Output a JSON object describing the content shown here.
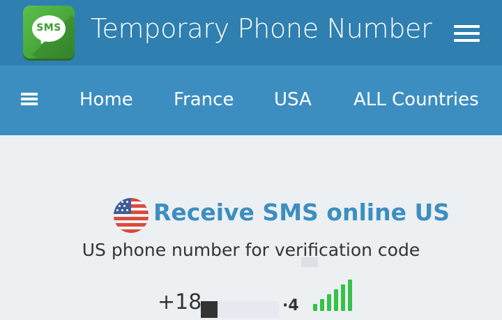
{
  "header": {
    "logo_text": "SMS",
    "title": "Temporary Phone Number",
    "menu_icon": "hamburger-menu-icon"
  },
  "nav": {
    "toggle_icon": "hamburger-icon",
    "links": [
      "Home",
      "France",
      "USA",
      "ALL Countries"
    ]
  },
  "main": {
    "flag_icon": "us-flag-icon",
    "heading": "Receive SMS online US",
    "subheading": "US phone number for verification code",
    "phone_prefix": "+18",
    "phone_partial_tail": "·4",
    "signal_icon": "signal-strength-icon"
  },
  "colors": {
    "header_bg": "#2f7fb0",
    "nav_bg": "#3d8ec0",
    "accent": "#3d8ec0",
    "signal": "#37c04a"
  }
}
